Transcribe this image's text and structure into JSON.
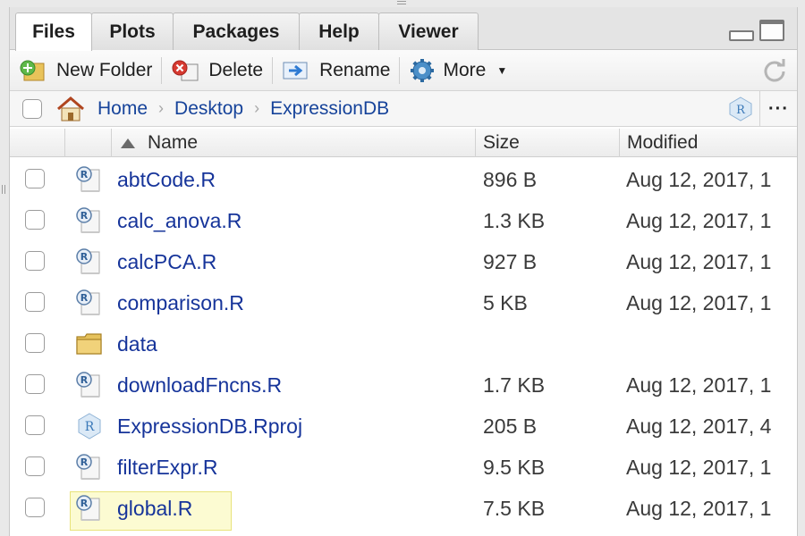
{
  "tabs": [
    {
      "label": "Files",
      "active": true
    },
    {
      "label": "Plots",
      "active": false
    },
    {
      "label": "Packages",
      "active": false
    },
    {
      "label": "Help",
      "active": false
    },
    {
      "label": "Viewer",
      "active": false
    }
  ],
  "toolbar": {
    "new_folder": "New Folder",
    "delete": "Delete",
    "rename": "Rename",
    "more": "More"
  },
  "breadcrumb": [
    "Home",
    "Desktop",
    "ExpressionDB"
  ],
  "more_menu": "···",
  "columns": {
    "name": "Name",
    "size": "Size",
    "modified": "Modified",
    "sort_column": "Name",
    "sort_direction": "ascending"
  },
  "files": [
    {
      "name": "abtCode.R",
      "size": "896 B",
      "modified": "Aug 12, 2017, 1",
      "type": "r-file"
    },
    {
      "name": "calc_anova.R",
      "size": "1.3 KB",
      "modified": "Aug 12, 2017, 1",
      "type": "r-file"
    },
    {
      "name": "calcPCA.R",
      "size": "927 B",
      "modified": "Aug 12, 2017, 1",
      "type": "r-file"
    },
    {
      "name": "comparison.R",
      "size": "5 KB",
      "modified": "Aug 12, 2017, 1",
      "type": "r-file"
    },
    {
      "name": "data",
      "size": "",
      "modified": "",
      "type": "folder"
    },
    {
      "name": "downloadFncns.R",
      "size": "1.7 KB",
      "modified": "Aug 12, 2017, 1",
      "type": "r-file"
    },
    {
      "name": "ExpressionDB.Rproj",
      "size": "205 B",
      "modified": "Aug 12, 2017, 4",
      "type": "rproj-file"
    },
    {
      "name": "filterExpr.R",
      "size": "9.5 KB",
      "modified": "Aug 12, 2017, 1",
      "type": "r-file"
    },
    {
      "name": "global.R",
      "size": "7.5 KB",
      "modified": "Aug 12, 2017, 1",
      "type": "r-file",
      "selected": true
    }
  ],
  "colors": {
    "link": "#16349a",
    "crumb": "#16439a",
    "highlight": "#fcfbd2",
    "highlight_border": "#e8e37a",
    "tabbar_bg": "#e4e4e4"
  }
}
